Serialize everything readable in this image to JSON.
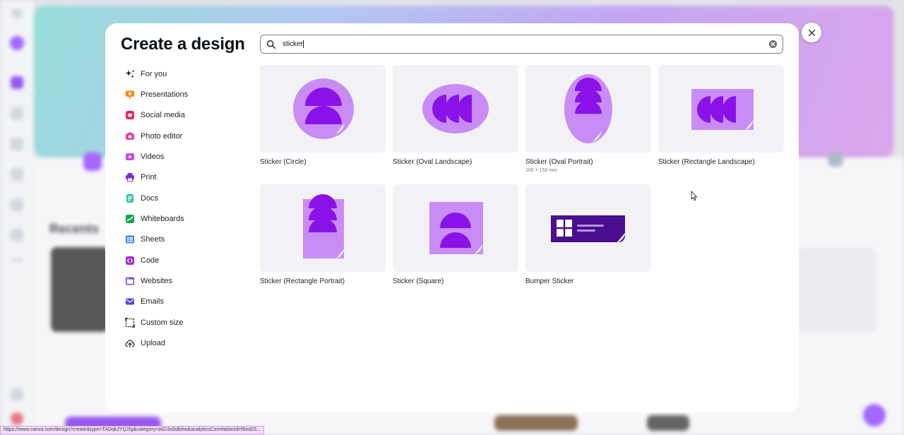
{
  "modal": {
    "title": "Create a design",
    "close_icon": "close-icon"
  },
  "search": {
    "value": "sticker",
    "placeholder": "Search",
    "search_icon": "search-icon",
    "clear_icon": "clear-icon"
  },
  "nav": {
    "items": [
      {
        "label": "For you",
        "icon": "sparkle-icon",
        "color": "#0d1216"
      },
      {
        "label": "Presentations",
        "icon": "presentation-icon",
        "color": "#ff8a00"
      },
      {
        "label": "Social media",
        "icon": "heart-icon",
        "color": "#e8245b"
      },
      {
        "label": "Photo editor",
        "icon": "camera-icon",
        "color": "#e33ea6"
      },
      {
        "label": "Videos",
        "icon": "video-icon",
        "color": "#c44ee8"
      },
      {
        "label": "Print",
        "icon": "printer-icon",
        "color": "#7b2bd6"
      },
      {
        "label": "Docs",
        "icon": "doc-icon",
        "color": "#2ec4a6"
      },
      {
        "label": "Whiteboards",
        "icon": "whiteboard-icon",
        "color": "#17a34a"
      },
      {
        "label": "Sheets",
        "icon": "sheet-icon",
        "color": "#3b82f6"
      },
      {
        "label": "Code",
        "icon": "code-icon",
        "color": "#9c27d6"
      },
      {
        "label": "Websites",
        "icon": "website-icon",
        "color": "#5a54e6"
      },
      {
        "label": "Emails",
        "icon": "email-icon",
        "color": "#4f46e5"
      },
      {
        "label": "Custom size",
        "icon": "custom-size-icon",
        "color": "#1d2125"
      },
      {
        "label": "Upload",
        "icon": "upload-icon",
        "color": "#1d2125"
      }
    ]
  },
  "results": [
    {
      "label": "Sticker (Circle)",
      "subtitle": "",
      "shape": "circle"
    },
    {
      "label": "Sticker (Oval Landscape)",
      "subtitle": "",
      "shape": "oval-landscape"
    },
    {
      "label": "Sticker (Oval Portrait)",
      "subtitle": "100 × 150 mm",
      "shape": "oval-portrait"
    },
    {
      "label": "Sticker (Rectangle Landscape)",
      "subtitle": "",
      "shape": "rect-landscape"
    },
    {
      "label": "Sticker (Rectangle Portrait)",
      "subtitle": "",
      "shape": "rect-portrait"
    },
    {
      "label": "Sticker (Square)",
      "subtitle": "",
      "shape": "square"
    },
    {
      "label": "Bumper Sticker",
      "subtitle": "",
      "shape": "bumper"
    }
  ],
  "background": {
    "recents_heading": "Recents"
  },
  "status_bar": {
    "url": "https://www.canva.com/design?create&type=TADqkJYQ2tg&category=tAD3s0idbhw&analyticsCorrelationId=f6ed23..."
  },
  "colors": {
    "accent": "#8b3dff",
    "sticker_light": "#c98cf5",
    "sticker_dark": "#8a12e8",
    "bumper_dark": "#4a0e8f"
  }
}
